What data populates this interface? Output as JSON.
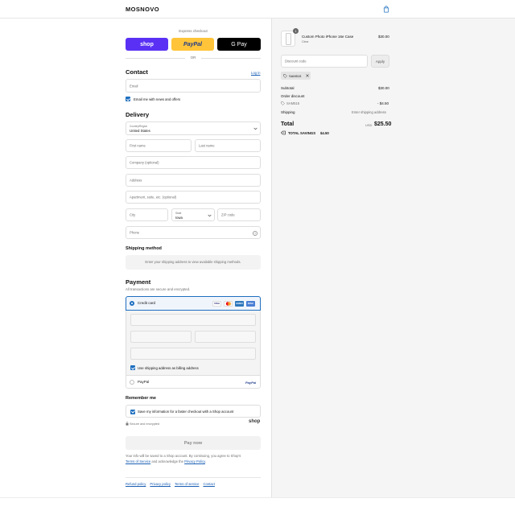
{
  "header": {
    "brand": "MOSNOVO",
    "cart_icon": "shopping-bag-icon"
  },
  "express": {
    "label": "Express checkout",
    "shop_label": "shop",
    "paypal_label": "PayPal",
    "gpay_label": "G Pay",
    "or_label": "OR",
    "colors": {
      "shop": "#5a31f4",
      "paypal": "#ffc439",
      "gpay": "#000000"
    }
  },
  "contact": {
    "title": "Contact",
    "login_link": "Log in",
    "email_placeholder": "Email",
    "news_label": "Email me with news and offers"
  },
  "delivery": {
    "title": "Delivery",
    "country_label": "Country/Region",
    "country_value": "United States",
    "first_name": "First name",
    "last_name": "Last name",
    "company": "Company (optional)",
    "address": "Address",
    "apartment": "Apartment, suite, etc. (optional)",
    "city": "City",
    "state_label": "State",
    "state_value": "Iowa",
    "zip": "ZIP code",
    "phone": "Phone"
  },
  "shipping": {
    "title": "Shipping method",
    "notice": "Enter your shipping address to view available shipping methods."
  },
  "payment": {
    "title": "Payment",
    "secure_note": "All transactions are secure and encrypted.",
    "credit_card_label": "Credit card",
    "card_brands": [
      "VISA",
      "MC",
      "AMEX",
      "DISC"
    ],
    "billing_label": "Use shipping address as billing address",
    "paypal_label": "PayPal",
    "paypal_logo": "PayPal"
  },
  "remember": {
    "title": "Remember me",
    "save_label": "Save my information for a faster checkout with a Shop account",
    "secure_label": "Secure and encrypted",
    "shop_logo": "shop"
  },
  "pay_button": "Pay now",
  "legal": {
    "line1": "Your info will be saved to a Shop account. By continuing, you agree to Shop's",
    "terms": "Terms of Service",
    "and_ack": "and acknowledge the",
    "privacy": "Privacy Policy",
    "period": "."
  },
  "footer_links": [
    "Refund policy",
    "Privacy policy",
    "Terms of service",
    "Contact"
  ],
  "summary": {
    "product": {
      "name": "Custom Photo iPhone 16e Case",
      "variant": "Clear",
      "price": "$30.00",
      "qty": "1"
    },
    "discount_placeholder": "Discount code",
    "apply_label": "Apply",
    "applied_code": "SAM515",
    "subtotal_label": "Subtotal",
    "subtotal_value": "$30.00",
    "order_discount_label": "Order discount",
    "discount_code": "SAM515",
    "discount_value": "- $4.50",
    "shipping_label": "Shipping",
    "shipping_value": "Enter shipping address",
    "total_label": "Total",
    "currency": "USD",
    "total_value": "$25.50",
    "savings_label": "TOTAL SAVINGS",
    "savings_value": "$4.50"
  }
}
